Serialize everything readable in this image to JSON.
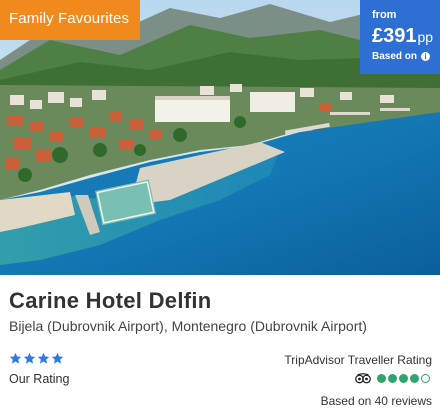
{
  "card": {
    "badge": "Family Favourites",
    "price": {
      "from_label": "from",
      "amount": "£391",
      "unit": "pp",
      "based_on": "Based on"
    },
    "hotel_name": "Carine Hotel Delfin",
    "location": "Bijela (Dubrovnik Airport), Montenegro (Dubrovnik Airport)",
    "our_rating": {
      "label": "Our Rating",
      "stars": 4,
      "max": 4
    },
    "tripadvisor": {
      "title": "TripAdvisor Traveller Rating",
      "bubbles": 4,
      "max": 5,
      "reviews": "Based on 40 reviews"
    }
  },
  "colors": {
    "badge": "#f08a1c",
    "price_box": "#2d6fd2",
    "stars": "#2f7be0",
    "bubbles": "#2fa56d"
  }
}
